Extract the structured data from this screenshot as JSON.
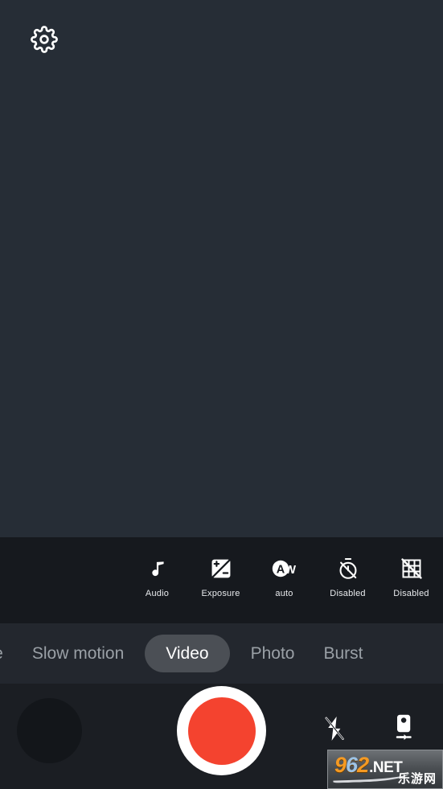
{
  "app": {
    "mode_title": "Video"
  },
  "viewfinder": {
    "settings_icon": "gear-icon"
  },
  "toolbar": {
    "items": [
      {
        "icon": "music-note-icon",
        "label": "Audio",
        "name": "audio"
      },
      {
        "icon": "exposure-icon",
        "label": "Exposure",
        "name": "exposure"
      },
      {
        "icon": "auto-white-balance-icon",
        "label": "auto",
        "name": "white-balance"
      },
      {
        "icon": "timer-off-icon",
        "label": "Disabled",
        "name": "timer"
      },
      {
        "icon": "grid-off-icon",
        "label": "Disabled",
        "name": "grid"
      }
    ]
  },
  "modes": {
    "items": [
      {
        "label": "ose",
        "selected": false,
        "truncated": true
      },
      {
        "label": "Slow motion",
        "selected": false,
        "truncated": false
      },
      {
        "label": "Video",
        "selected": true,
        "truncated": false
      },
      {
        "label": "Photo",
        "selected": false,
        "truncated": false
      },
      {
        "label": "Burst",
        "selected": false,
        "truncated": false
      }
    ],
    "selected": "Video"
  },
  "bottom_bar": {
    "thumbnail": "gallery-thumbnail",
    "record_button": "record-button",
    "record_color": "#f4432f",
    "flash_icon": "flash-off-icon",
    "switch_icon": "camera-switch-icon"
  },
  "watermark": {
    "digits_1": "9",
    "digits_2": "6",
    "digits_3": "2",
    "suffix": ".NET",
    "chinese": "乐游网"
  },
  "colors": {
    "viewfinder_bg": "#262d36",
    "toolbar_bg": "#16191e",
    "modebar_bg": "#23272e",
    "bottombar_bg": "#1b1e23",
    "selected_chip": "#4b4f55",
    "record_red": "#f4432f",
    "label_text": "#e8eaed",
    "mode_text": "#9aa0a6"
  }
}
